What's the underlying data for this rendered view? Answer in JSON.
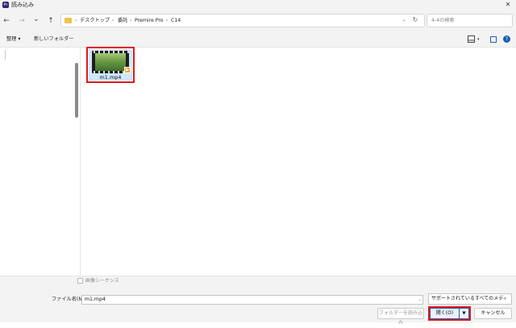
{
  "window": {
    "title": "読み込み",
    "app_badge": "Pr",
    "close_glyph": "✕"
  },
  "nav": {
    "back_glyph": "←",
    "forward_glyph": "→",
    "recent_glyph": "⌄",
    "up_glyph": "↑",
    "breadcrumbs": [
      "デスクトップ",
      "委託",
      "Premire Pro",
      "C14"
    ],
    "crumb_separator": "›",
    "address_dropdown_glyph": "⌄",
    "refresh_glyph": "↻",
    "search_placeholder": "4-4の検索"
  },
  "commandbar": {
    "organize": "整理 ▾",
    "new_folder": "新しいフォルダー",
    "view_dropdown": "▾",
    "help_glyph": "?"
  },
  "files": [
    {
      "name": "m1.mp4",
      "icon": "video-file-icon",
      "selected": true,
      "badge_glyph": "▶"
    }
  ],
  "bottom": {
    "image_sequence_label": "画像シーケンス",
    "image_sequence_checked": false,
    "filename_label": "ファイル名(N):",
    "filename_value": "m1.mp4",
    "filename_dropdown_glyph": "⌄",
    "filetype_value": "サポートされているすべてのメディア (*",
    "import_folder_button": "フォルダーを読み込み",
    "open_button": "開く(O)",
    "open_dropdown_glyph": "▼",
    "cancel_button": "キャンセル"
  },
  "colors": {
    "highlight_red": "#e21919",
    "selection_blue": "#cde8ff",
    "accent": "#1a5fb4"
  }
}
